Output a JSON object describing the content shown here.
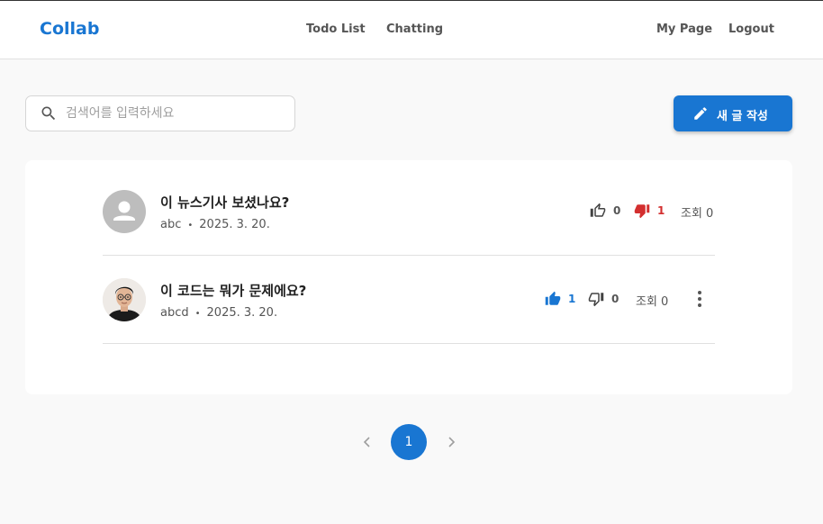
{
  "header": {
    "brand": "Collab",
    "nav_center": [
      "Todo List",
      "Chatting"
    ],
    "nav_right": [
      "My Page",
      "Logout"
    ]
  },
  "search": {
    "placeholder": "검색어를 입력하세요",
    "value": ""
  },
  "new_post_button": "새 글 작성",
  "posts": [
    {
      "title": "이 뉴스기사 보셨나요?",
      "author": "abc",
      "date": "2025. 3. 20.",
      "likes": "0",
      "dislikes": "1",
      "views": "조회 0",
      "liked": false,
      "disliked": true
    },
    {
      "title": "이 코드는 뭐가 문제에요?",
      "author": "abcd",
      "date": "2025. 3. 20.",
      "likes": "1",
      "dislikes": "0",
      "views": "조회 0",
      "liked": true,
      "disliked": false
    }
  ],
  "pagination": {
    "current": "1"
  },
  "colors": {
    "primary": "#1976d2",
    "dislike_active": "#d32f2f",
    "text_muted": "#555555"
  }
}
